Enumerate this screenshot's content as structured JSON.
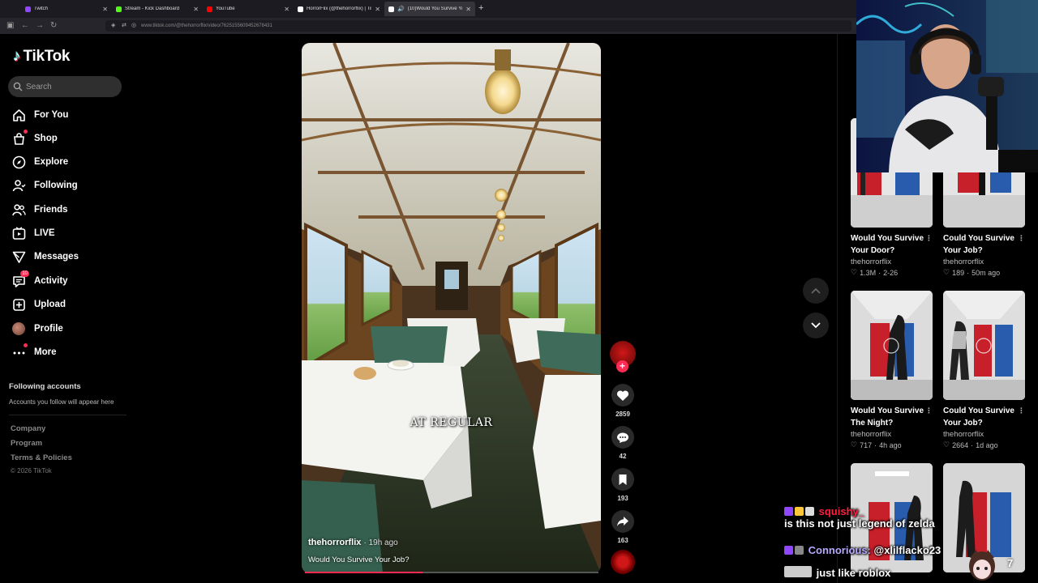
{
  "browser": {
    "tabs": [
      {
        "title": "Twitch",
        "color": "#9146ff"
      },
      {
        "title": "Stream - Kick Dashboard",
        "color": "#53fc18"
      },
      {
        "title": "YouTube",
        "color": "#ff0000"
      },
      {
        "title": "HorrorFlix (@thehorrorflix) | Tik",
        "color": "#ffffff"
      },
      {
        "title": "(10)Would You Survive Your",
        "color": "#ffffff",
        "active": true
      }
    ],
    "url": "www.tiktok.com/@thehorrorflix/video/7625155609452678431"
  },
  "sidebar": {
    "logo": "TikTok",
    "search_placeholder": "Search",
    "nav": [
      {
        "label": "For You",
        "icon": "home-icon"
      },
      {
        "label": "Shop",
        "icon": "shop-icon"
      },
      {
        "label": "Explore",
        "icon": "compass-icon"
      },
      {
        "label": "Following",
        "icon": "following-icon"
      },
      {
        "label": "Friends",
        "icon": "friends-icon"
      },
      {
        "label": "LIVE",
        "icon": "live-icon"
      },
      {
        "label": "Messages",
        "icon": "messages-icon"
      },
      {
        "label": "Activity",
        "icon": "activity-icon",
        "badge": "10"
      },
      {
        "label": "Upload",
        "icon": "upload-icon"
      },
      {
        "label": "Profile",
        "icon": "profile-avatar"
      },
      {
        "label": "More",
        "icon": "more-icon"
      }
    ],
    "following_heading": "Following accounts",
    "following_sub": "Accounts you follow will appear here",
    "footer": [
      "Company",
      "Program",
      "Terms & Policies"
    ],
    "copyright": "© 2026 TikTok"
  },
  "video": {
    "caption": "AT REGULAR",
    "author": "thehorrorflix",
    "time": "· 19h ago",
    "description": "Would You Survive Your Job?",
    "progress": 0.4
  },
  "actions": {
    "likes": "2859",
    "comments": "42",
    "saves": "193",
    "shares": "163"
  },
  "grid": [
    {
      "title": "Would You Survive Your Door?",
      "author": "thehorrorflix",
      "likes": "1.3M",
      "time": "2-26"
    },
    {
      "title": "Could You Survive Your Job?",
      "author": "thehorrorflix",
      "likes": "189",
      "time": "50m ago"
    },
    {
      "title": "Would You Survive The Night?",
      "author": "thehorrorflix",
      "likes": "717",
      "time": "4h ago"
    },
    {
      "title": "Could You Survive Your Job?",
      "author": "thehorrorflix",
      "likes": "2664",
      "time": "1d ago"
    }
  ],
  "chat": [
    {
      "user": "squishy_",
      "user_color": "#ff2040",
      "message": "is this not just legend of zelda"
    },
    {
      "user": "Connorious:",
      "user_color": "#b8a8ff",
      "message": "@xlilflacko23"
    },
    {
      "user": "",
      "user_color": "#ffffff",
      "message": "just like roblox"
    }
  ],
  "overlay_number": "7"
}
